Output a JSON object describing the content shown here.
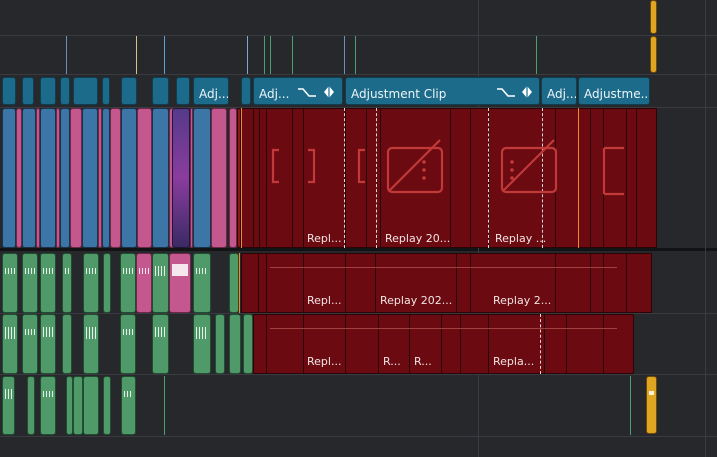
{
  "timeline": {
    "adjustment_clips": [
      {
        "label": "Adj..."
      },
      {
        "label": "Adj..."
      },
      {
        "label": "Adjustment Clip"
      },
      {
        "label": "Adj..."
      },
      {
        "label": "Adjustme..."
      }
    ],
    "video_clips": [
      {
        "label": "Repl..."
      },
      {
        "label": "Replay 20..."
      },
      {
        "label": "Replay ..."
      }
    ],
    "audio1_clips": [
      {
        "label": "Repl..."
      },
      {
        "label": "Replay 202..."
      },
      {
        "label": "Replay 2..."
      }
    ],
    "audio2_clips": [
      {
        "label": "Repl..."
      },
      {
        "label": "R..."
      },
      {
        "label": "R..."
      },
      {
        "label": "Repla..."
      }
    ]
  },
  "colors": {
    "background": "#27282c",
    "adjustment": "#1c6b8a",
    "video_blue": "#3c76a7",
    "video_pink": "#c4588e",
    "audio_green": "#4f9a68",
    "replay_red": "#6b0a10",
    "marker_yellow": "#e0a521",
    "playhead_orange": "#f08a2a"
  },
  "icons": [
    "curve-icon",
    "keyframe-icon",
    "broken-media-icon",
    "bracket-icon"
  ]
}
